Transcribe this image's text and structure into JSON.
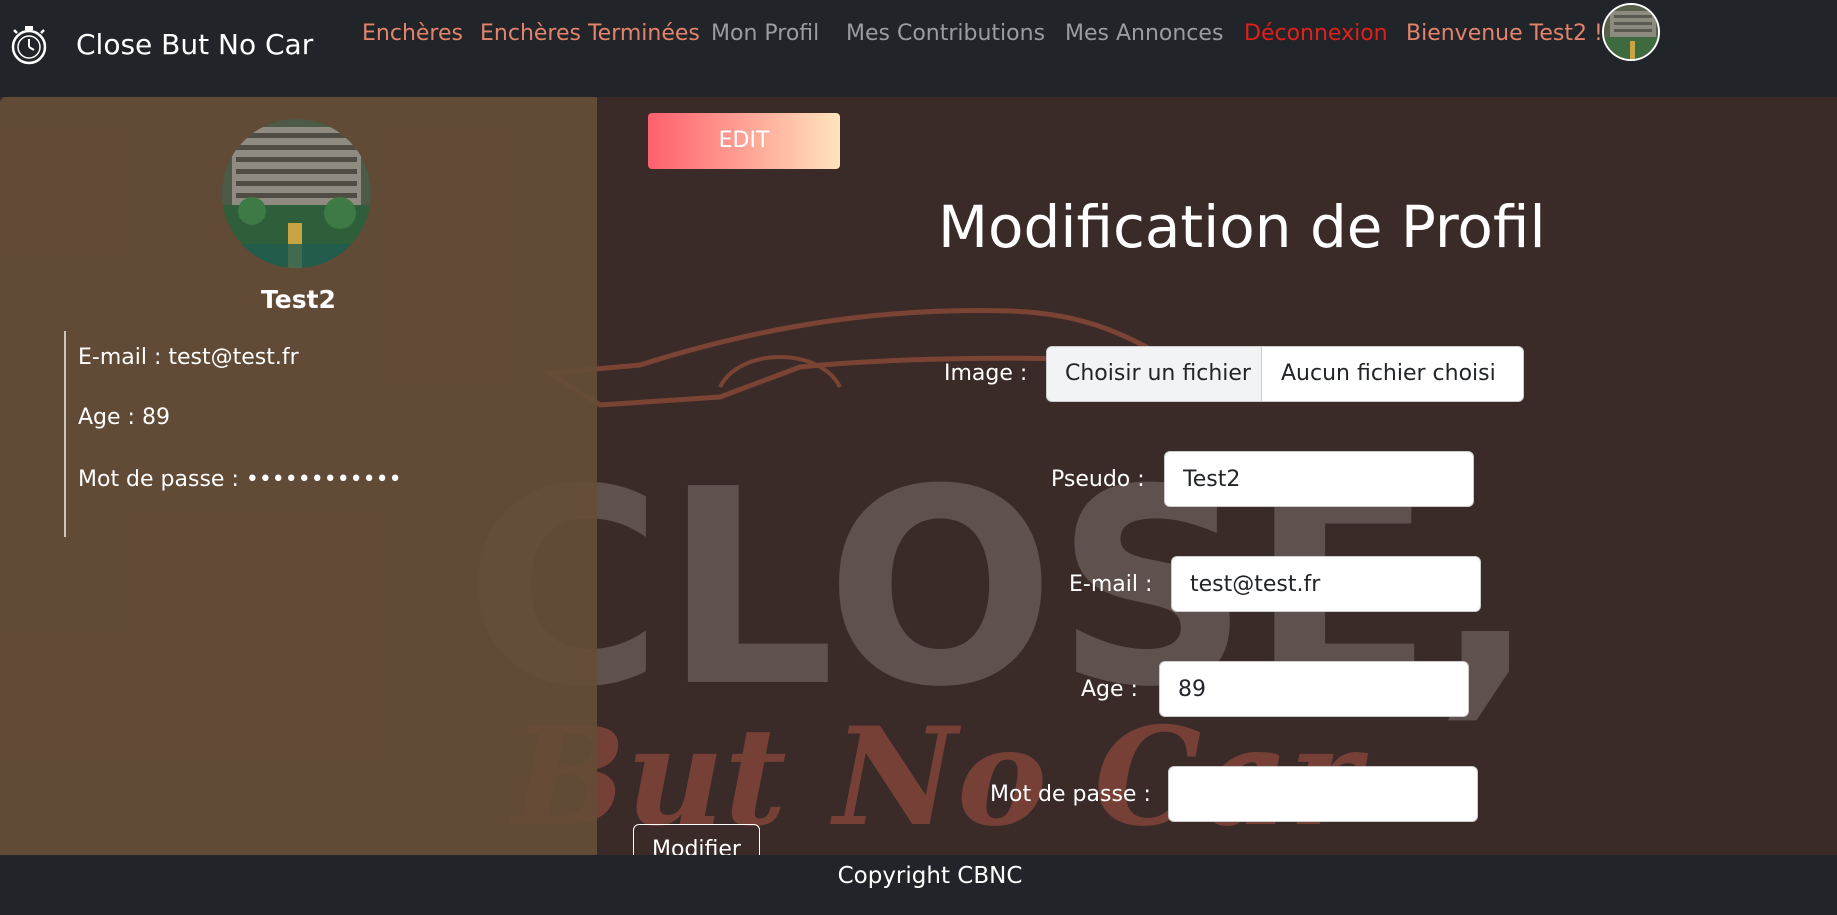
{
  "navbar": {
    "brand": "Close But No Car",
    "items": [
      {
        "label": "Enchères"
      },
      {
        "label": "Enchères Terminées"
      },
      {
        "label": "Mon Profil"
      },
      {
        "label": "Mes Contributions"
      },
      {
        "label": "Mes Annonces"
      },
      {
        "label": "Déconnexion"
      },
      {
        "label": "Bienvenue Test2 !"
      }
    ]
  },
  "sidebar": {
    "name": "Test2",
    "email": "E-mail : test@test.fr",
    "age": "Age : 89",
    "password": "Mot de passe : ••••••••••••"
  },
  "main": {
    "edit_label": "EDIT",
    "title": "Modification de Profil",
    "watermark_big": "CLOSE,",
    "watermark_script": "But No Car"
  },
  "form": {
    "image_label": "Image :",
    "file_button": "Choisir un fichier",
    "file_status": "Aucun fichier choisi",
    "pseudo_label": "Pseudo :",
    "pseudo_value": "Test2",
    "email_label": "E-mail :",
    "email_value": "test@test.fr",
    "age_label": "Age :",
    "age_value": "89",
    "password_label": "Mot de passe :",
    "password_value": "",
    "submit_label": "Modifier"
  },
  "footer": {
    "copyright": "Copyright CBNC"
  },
  "colors": {
    "nav_accent": "#e4836c",
    "nav_muted": "#9a9d9f",
    "nav_logout": "#e0211b",
    "background": "#3a2b29",
    "sidebar": "#654d37"
  },
  "icons": {
    "brand": "stopwatch-icon"
  }
}
